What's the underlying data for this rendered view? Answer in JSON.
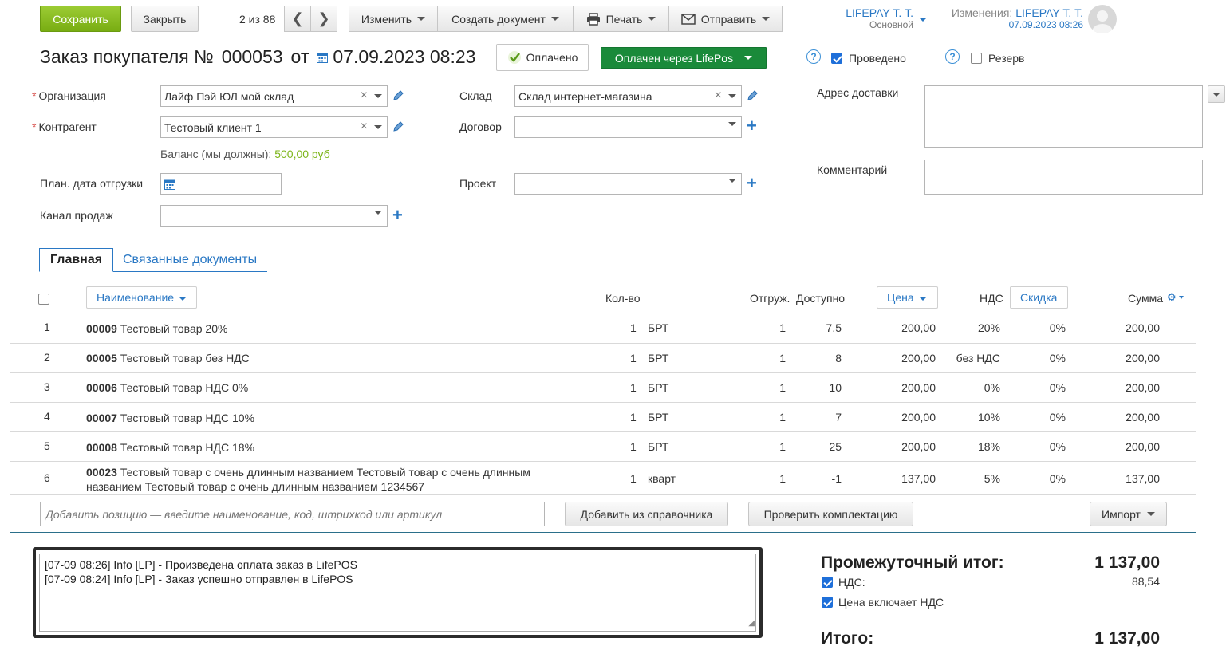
{
  "toolbar": {
    "save": "Сохранить",
    "close": "Закрыть",
    "counter": "2 из 88",
    "edit": "Изменить",
    "create_doc": "Создать документ",
    "print": "Печать",
    "send": "Отправить"
  },
  "user": {
    "name": "LIFEPAY Т. Т.",
    "role": "Основной",
    "changes_label": "Изменения:",
    "changes_user": "LIFEPAY Т. Т.",
    "changes_date": "07.09.2023 08:26"
  },
  "header": {
    "title": "Заказ покупателя №",
    "number": "000053",
    "from": "от",
    "date": "07.09.2023 08:23",
    "paid_label": "Оплачено",
    "paid_via": "Оплачен через LifePos",
    "posted_label": "Проведено",
    "reserve_label": "Резерв",
    "posted_checked": true,
    "reserve_checked": false
  },
  "form": {
    "org_label": "Организация",
    "org_value": "Лайф Пэй ЮЛ мой склад",
    "counterparty_label": "Контрагент",
    "counterparty_value": "Тестовый клиент 1",
    "balance_label": "Баланс (мы должны):",
    "balance_value": "500,00 руб",
    "ship_date_label": "План. дата отгрузки",
    "sales_channel_label": "Канал продаж",
    "warehouse_label": "Склад",
    "warehouse_value": "Склад интернет-магазина",
    "contract_label": "Договор",
    "project_label": "Проект",
    "address_label": "Адрес доставки",
    "comment_label": "Комментарий"
  },
  "tabs": [
    "Главная",
    "Связанные документы"
  ],
  "table": {
    "headers": {
      "name": "Наименование",
      "qty": "Кол-во",
      "shipped": "Отгруж.",
      "available": "Доступно",
      "price": "Цена",
      "vat": "НДС",
      "discount": "Скидка",
      "sum": "Сумма"
    },
    "rows": [
      {
        "n": "1",
        "code": "00009",
        "name": "Тестовый товар 20%",
        "name2": "",
        "qty": "1",
        "unit": "БРТ",
        "shipped": "1",
        "available": "7,5",
        "price": "200,00",
        "vat": "20%",
        "discount": "0%",
        "sum": "200,00"
      },
      {
        "n": "2",
        "code": "00005",
        "name": "Тестовый товар без НДС",
        "name2": "",
        "qty": "1",
        "unit": "БРТ",
        "shipped": "1",
        "available": "8",
        "price": "200,00",
        "vat": "без НДС",
        "discount": "0%",
        "sum": "200,00"
      },
      {
        "n": "3",
        "code": "00006",
        "name": "Тестовый товар НДС 0%",
        "name2": "",
        "qty": "1",
        "unit": "БРТ",
        "shipped": "1",
        "available": "10",
        "price": "200,00",
        "vat": "0%",
        "discount": "0%",
        "sum": "200,00"
      },
      {
        "n": "4",
        "code": "00007",
        "name": "Тестовый товар НДС 10%",
        "name2": "",
        "qty": "1",
        "unit": "БРТ",
        "shipped": "1",
        "available": "7",
        "price": "200,00",
        "vat": "10%",
        "discount": "0%",
        "sum": "200,00"
      },
      {
        "n": "5",
        "code": "00008",
        "name": "Тестовый товар НДС 18%",
        "name2": "",
        "qty": "1",
        "unit": "БРТ",
        "shipped": "1",
        "available": "25",
        "price": "200,00",
        "vat": "18%",
        "discount": "0%",
        "sum": "200,00"
      },
      {
        "n": "6",
        "code": "00023",
        "name": "Тестовый товар с очень длинным названием Тестовый товар с очень длинным",
        "name2": "названием Тестовый товар с очень длинным названием 1234567",
        "qty": "1",
        "unit": "кварт",
        "shipped": "1",
        "available": "-1",
        "price": "137,00",
        "vat": "5%",
        "discount": "0%",
        "sum": "137,00"
      }
    ]
  },
  "actions": {
    "add_placeholder": "Добавить позицию — введите наименование, код, штрихкод или артикул",
    "add_from_catalog": "Добавить из справочника",
    "check_kit": "Проверить комплектацию",
    "import": "Импорт"
  },
  "log": [
    "[07-09 08:26] Info [LP] - Произведена оплата заказ в LifePOS",
    "[07-09 08:24] Info [LP] - Заказ успешно отправлен в LifePOS"
  ],
  "summary": {
    "subtotal_label": "Промежуточный итог:",
    "subtotal_value": "1 137,00",
    "vat_label": "НДС:",
    "vat_value": "88,54",
    "price_incl_vat_label": "Цена включает НДС",
    "total_label": "Итого:",
    "total_value": "1 137,00"
  },
  "colors": {
    "accent": "#2a78c4",
    "save_green": "#84b91c",
    "lifepos_green": "#1a8a3a",
    "balance_green": "#7cb518"
  }
}
